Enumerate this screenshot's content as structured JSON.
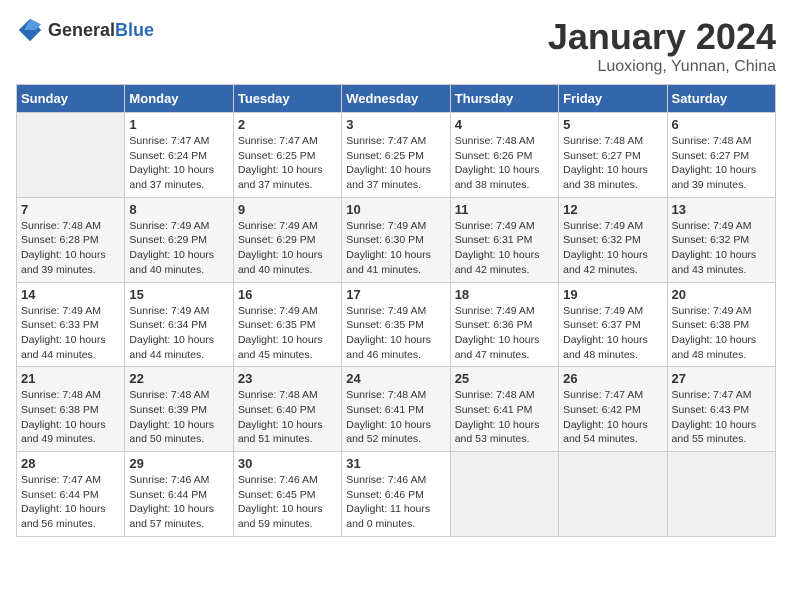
{
  "header": {
    "logo_general": "General",
    "logo_blue": "Blue",
    "month_year": "January 2024",
    "location": "Luoxiong, Yunnan, China"
  },
  "days_of_week": [
    "Sunday",
    "Monday",
    "Tuesday",
    "Wednesday",
    "Thursday",
    "Friday",
    "Saturday"
  ],
  "weeks": [
    [
      {
        "day": "",
        "sunrise": "",
        "sunset": "",
        "daylight": ""
      },
      {
        "day": "1",
        "sunrise": "Sunrise: 7:47 AM",
        "sunset": "Sunset: 6:24 PM",
        "daylight": "Daylight: 10 hours and 37 minutes."
      },
      {
        "day": "2",
        "sunrise": "Sunrise: 7:47 AM",
        "sunset": "Sunset: 6:25 PM",
        "daylight": "Daylight: 10 hours and 37 minutes."
      },
      {
        "day": "3",
        "sunrise": "Sunrise: 7:47 AM",
        "sunset": "Sunset: 6:25 PM",
        "daylight": "Daylight: 10 hours and 37 minutes."
      },
      {
        "day": "4",
        "sunrise": "Sunrise: 7:48 AM",
        "sunset": "Sunset: 6:26 PM",
        "daylight": "Daylight: 10 hours and 38 minutes."
      },
      {
        "day": "5",
        "sunrise": "Sunrise: 7:48 AM",
        "sunset": "Sunset: 6:27 PM",
        "daylight": "Daylight: 10 hours and 38 minutes."
      },
      {
        "day": "6",
        "sunrise": "Sunrise: 7:48 AM",
        "sunset": "Sunset: 6:27 PM",
        "daylight": "Daylight: 10 hours and 39 minutes."
      }
    ],
    [
      {
        "day": "7",
        "sunrise": "Sunrise: 7:48 AM",
        "sunset": "Sunset: 6:28 PM",
        "daylight": "Daylight: 10 hours and 39 minutes."
      },
      {
        "day": "8",
        "sunrise": "Sunrise: 7:49 AM",
        "sunset": "Sunset: 6:29 PM",
        "daylight": "Daylight: 10 hours and 40 minutes."
      },
      {
        "day": "9",
        "sunrise": "Sunrise: 7:49 AM",
        "sunset": "Sunset: 6:29 PM",
        "daylight": "Daylight: 10 hours and 40 minutes."
      },
      {
        "day": "10",
        "sunrise": "Sunrise: 7:49 AM",
        "sunset": "Sunset: 6:30 PM",
        "daylight": "Daylight: 10 hours and 41 minutes."
      },
      {
        "day": "11",
        "sunrise": "Sunrise: 7:49 AM",
        "sunset": "Sunset: 6:31 PM",
        "daylight": "Daylight: 10 hours and 42 minutes."
      },
      {
        "day": "12",
        "sunrise": "Sunrise: 7:49 AM",
        "sunset": "Sunset: 6:32 PM",
        "daylight": "Daylight: 10 hours and 42 minutes."
      },
      {
        "day": "13",
        "sunrise": "Sunrise: 7:49 AM",
        "sunset": "Sunset: 6:32 PM",
        "daylight": "Daylight: 10 hours and 43 minutes."
      }
    ],
    [
      {
        "day": "14",
        "sunrise": "Sunrise: 7:49 AM",
        "sunset": "Sunset: 6:33 PM",
        "daylight": "Daylight: 10 hours and 44 minutes."
      },
      {
        "day": "15",
        "sunrise": "Sunrise: 7:49 AM",
        "sunset": "Sunset: 6:34 PM",
        "daylight": "Daylight: 10 hours and 44 minutes."
      },
      {
        "day": "16",
        "sunrise": "Sunrise: 7:49 AM",
        "sunset": "Sunset: 6:35 PM",
        "daylight": "Daylight: 10 hours and 45 minutes."
      },
      {
        "day": "17",
        "sunrise": "Sunrise: 7:49 AM",
        "sunset": "Sunset: 6:35 PM",
        "daylight": "Daylight: 10 hours and 46 minutes."
      },
      {
        "day": "18",
        "sunrise": "Sunrise: 7:49 AM",
        "sunset": "Sunset: 6:36 PM",
        "daylight": "Daylight: 10 hours and 47 minutes."
      },
      {
        "day": "19",
        "sunrise": "Sunrise: 7:49 AM",
        "sunset": "Sunset: 6:37 PM",
        "daylight": "Daylight: 10 hours and 48 minutes."
      },
      {
        "day": "20",
        "sunrise": "Sunrise: 7:49 AM",
        "sunset": "Sunset: 6:38 PM",
        "daylight": "Daylight: 10 hours and 48 minutes."
      }
    ],
    [
      {
        "day": "21",
        "sunrise": "Sunrise: 7:48 AM",
        "sunset": "Sunset: 6:38 PM",
        "daylight": "Daylight: 10 hours and 49 minutes."
      },
      {
        "day": "22",
        "sunrise": "Sunrise: 7:48 AM",
        "sunset": "Sunset: 6:39 PM",
        "daylight": "Daylight: 10 hours and 50 minutes."
      },
      {
        "day": "23",
        "sunrise": "Sunrise: 7:48 AM",
        "sunset": "Sunset: 6:40 PM",
        "daylight": "Daylight: 10 hours and 51 minutes."
      },
      {
        "day": "24",
        "sunrise": "Sunrise: 7:48 AM",
        "sunset": "Sunset: 6:41 PM",
        "daylight": "Daylight: 10 hours and 52 minutes."
      },
      {
        "day": "25",
        "sunrise": "Sunrise: 7:48 AM",
        "sunset": "Sunset: 6:41 PM",
        "daylight": "Daylight: 10 hours and 53 minutes."
      },
      {
        "day": "26",
        "sunrise": "Sunrise: 7:47 AM",
        "sunset": "Sunset: 6:42 PM",
        "daylight": "Daylight: 10 hours and 54 minutes."
      },
      {
        "day": "27",
        "sunrise": "Sunrise: 7:47 AM",
        "sunset": "Sunset: 6:43 PM",
        "daylight": "Daylight: 10 hours and 55 minutes."
      }
    ],
    [
      {
        "day": "28",
        "sunrise": "Sunrise: 7:47 AM",
        "sunset": "Sunset: 6:44 PM",
        "daylight": "Daylight: 10 hours and 56 minutes."
      },
      {
        "day": "29",
        "sunrise": "Sunrise: 7:46 AM",
        "sunset": "Sunset: 6:44 PM",
        "daylight": "Daylight: 10 hours and 57 minutes."
      },
      {
        "day": "30",
        "sunrise": "Sunrise: 7:46 AM",
        "sunset": "Sunset: 6:45 PM",
        "daylight": "Daylight: 10 hours and 59 minutes."
      },
      {
        "day": "31",
        "sunrise": "Sunrise: 7:46 AM",
        "sunset": "Sunset: 6:46 PM",
        "daylight": "Daylight: 11 hours and 0 minutes."
      },
      {
        "day": "",
        "sunrise": "",
        "sunset": "",
        "daylight": ""
      },
      {
        "day": "",
        "sunrise": "",
        "sunset": "",
        "daylight": ""
      },
      {
        "day": "",
        "sunrise": "",
        "sunset": "",
        "daylight": ""
      }
    ]
  ]
}
